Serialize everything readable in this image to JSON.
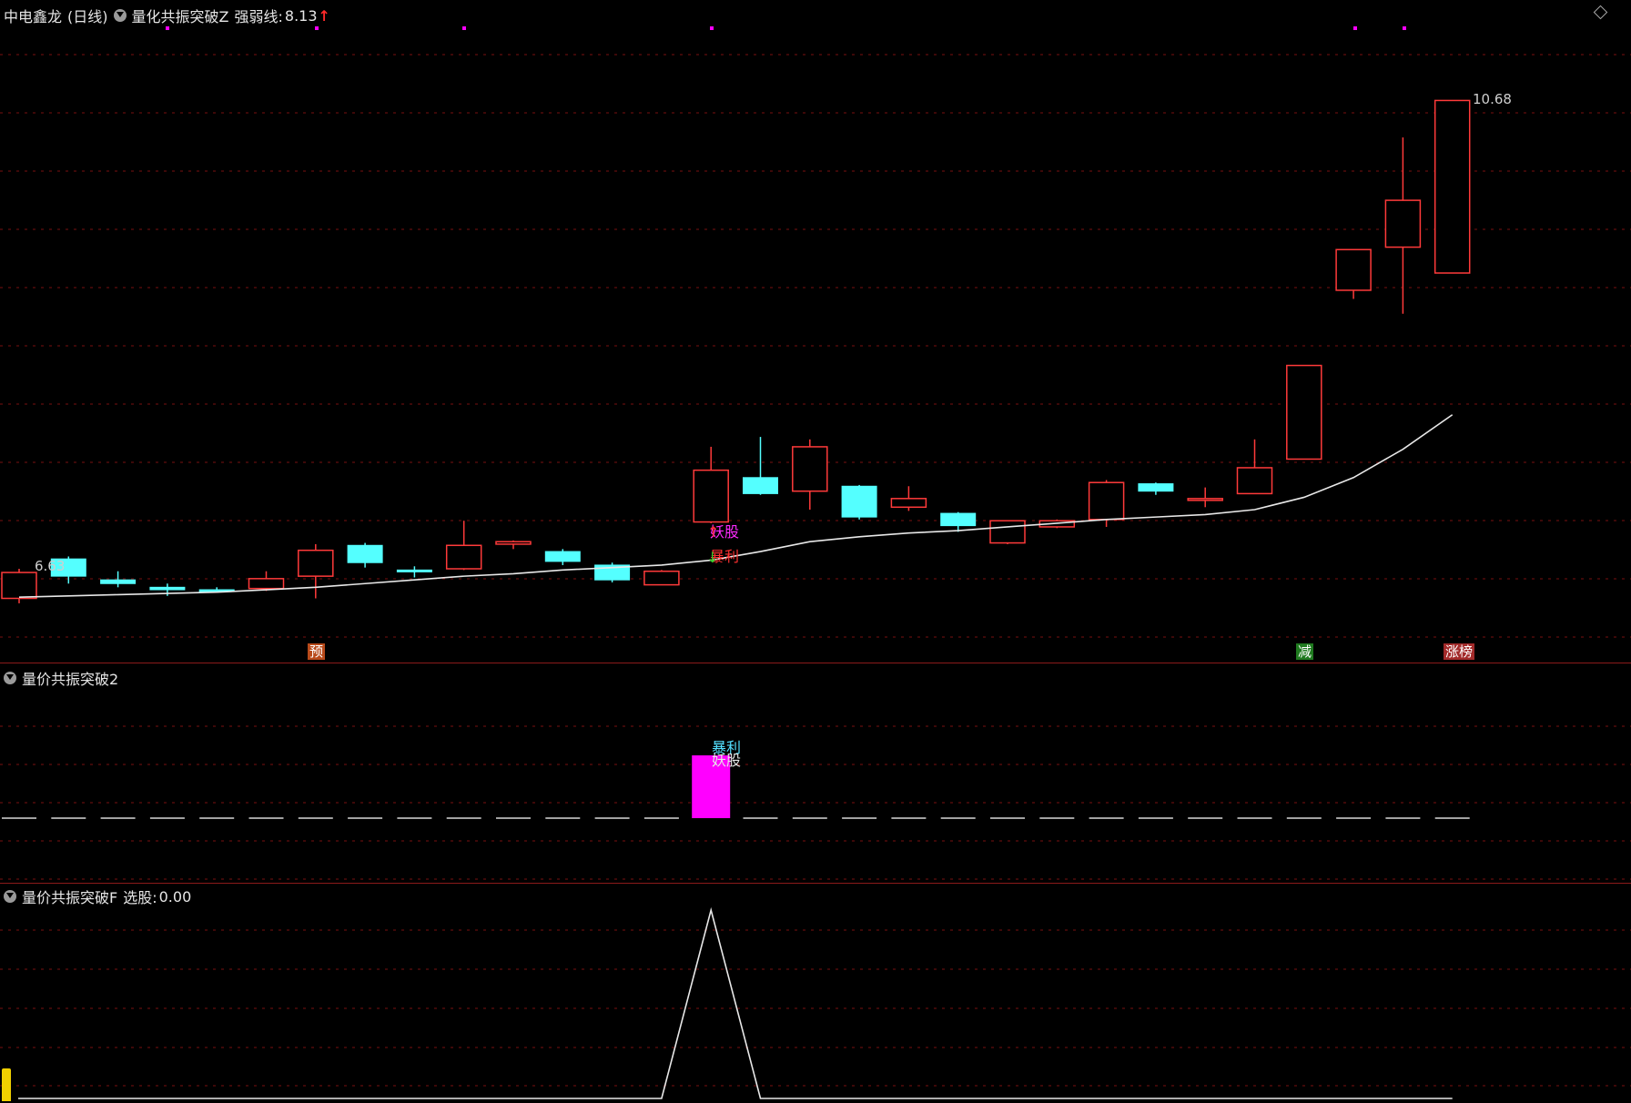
{
  "main": {
    "stock_name": "中电鑫龙",
    "period": "(日线)",
    "indicator_name": "量化共振突破Z",
    "line_label": "强弱线:",
    "line_value": "8.13",
    "high_label": "10.68",
    "low_label": "6.63",
    "tags": {
      "pre": "预",
      "reduce": "减",
      "limit_up": "涨榜",
      "demon": "妖股",
      "profit": "暴利"
    }
  },
  "vol_pane": {
    "indicator_name": "量价共振突破2",
    "tag_profit": "暴利",
    "tag_demon": "妖股"
  },
  "ind_pane": {
    "indicator_name": "量价共振突破F",
    "select_label": "选股:",
    "select_value": "0.00"
  },
  "colors": {
    "up": "#ff3a3a",
    "down": "#54ffff",
    "grid": "#7a1010",
    "line": "#e8e8e8",
    "magenta": "#ff00ff"
  },
  "chart_data": {
    "type": "candlestick",
    "series_count": 30,
    "ylim": [
      6.4,
      11.2
    ],
    "candles": [
      {
        "o": 6.64,
        "c": 6.85,
        "h": 6.88,
        "l": 6.6
      },
      {
        "o": 6.96,
        "c": 6.82,
        "h": 6.98,
        "l": 6.76
      },
      {
        "o": 6.79,
        "c": 6.76,
        "h": 6.86,
        "l": 6.73
      },
      {
        "o": 6.73,
        "c": 6.71,
        "h": 6.76,
        "l": 6.66
      },
      {
        "o": 6.71,
        "c": 6.7,
        "h": 6.73,
        "l": 6.69
      },
      {
        "o": 6.72,
        "c": 6.8,
        "h": 6.86,
        "l": 6.7
      },
      {
        "o": 6.82,
        "c": 7.03,
        "h": 7.08,
        "l": 6.64
      },
      {
        "o": 7.07,
        "c": 6.93,
        "h": 7.09,
        "l": 6.89
      },
      {
        "o": 6.87,
        "c": 6.86,
        "h": 6.9,
        "l": 6.81
      },
      {
        "o": 6.88,
        "c": 7.07,
        "h": 7.27,
        "l": 6.87
      },
      {
        "o": 7.08,
        "c": 7.1,
        "h": 7.11,
        "l": 7.04
      },
      {
        "o": 7.02,
        "c": 6.94,
        "h": 7.04,
        "l": 6.91
      },
      {
        "o": 6.91,
        "c": 6.79,
        "h": 6.93,
        "l": 6.77
      },
      {
        "o": 6.75,
        "c": 6.86,
        "h": 6.87,
        "l": 6.75
      },
      {
        "o": 7.26,
        "c": 7.68,
        "h": 7.87,
        "l": 7.25
      },
      {
        "o": 7.62,
        "c": 7.49,
        "h": 7.95,
        "l": 7.48
      },
      {
        "o": 7.51,
        "c": 7.87,
        "h": 7.93,
        "l": 7.36
      },
      {
        "o": 7.55,
        "c": 7.3,
        "h": 7.56,
        "l": 7.28
      },
      {
        "o": 7.38,
        "c": 7.45,
        "h": 7.55,
        "l": 7.35
      },
      {
        "o": 7.33,
        "c": 7.23,
        "h": 7.34,
        "l": 7.18
      },
      {
        "o": 7.09,
        "c": 7.27,
        "h": 7.27,
        "l": 7.08
      },
      {
        "o": 7.22,
        "c": 7.27,
        "h": 7.28,
        "l": 7.21
      },
      {
        "o": 7.28,
        "c": 7.58,
        "h": 7.6,
        "l": 7.22
      },
      {
        "o": 7.57,
        "c": 7.51,
        "h": 7.58,
        "l": 7.48
      },
      {
        "o": 7.45,
        "c": 7.45,
        "h": 7.54,
        "l": 7.38
      },
      {
        "o": 7.49,
        "c": 7.7,
        "h": 7.93,
        "l": 7.49
      },
      {
        "o": 7.77,
        "c": 8.53,
        "h": 8.53,
        "l": 7.77
      },
      {
        "o": 9.14,
        "c": 9.47,
        "h": 9.47,
        "l": 9.07
      },
      {
        "o": 9.49,
        "c": 9.87,
        "h": 10.38,
        "l": 8.95
      },
      {
        "o": 9.28,
        "c": 10.68,
        "h": 10.68,
        "l": 9.28
      }
    ],
    "strength_line": [
      6.65,
      6.66,
      6.67,
      6.68,
      6.69,
      6.71,
      6.73,
      6.76,
      6.79,
      6.82,
      6.84,
      6.87,
      6.89,
      6.91,
      6.95,
      7.02,
      7.1,
      7.14,
      7.17,
      7.19,
      7.22,
      7.25,
      7.28,
      7.3,
      7.32,
      7.36,
      7.46,
      7.62,
      7.85,
      8.13
    ],
    "volume_signal_index": 14,
    "select_signal": [
      0,
      0,
      0,
      0,
      0,
      0,
      0,
      0,
      0,
      0,
      0,
      0,
      0,
      0,
      1,
      0,
      0,
      0,
      0,
      0,
      0,
      0,
      0,
      0,
      0,
      0,
      0,
      0,
      0,
      0
    ]
  }
}
